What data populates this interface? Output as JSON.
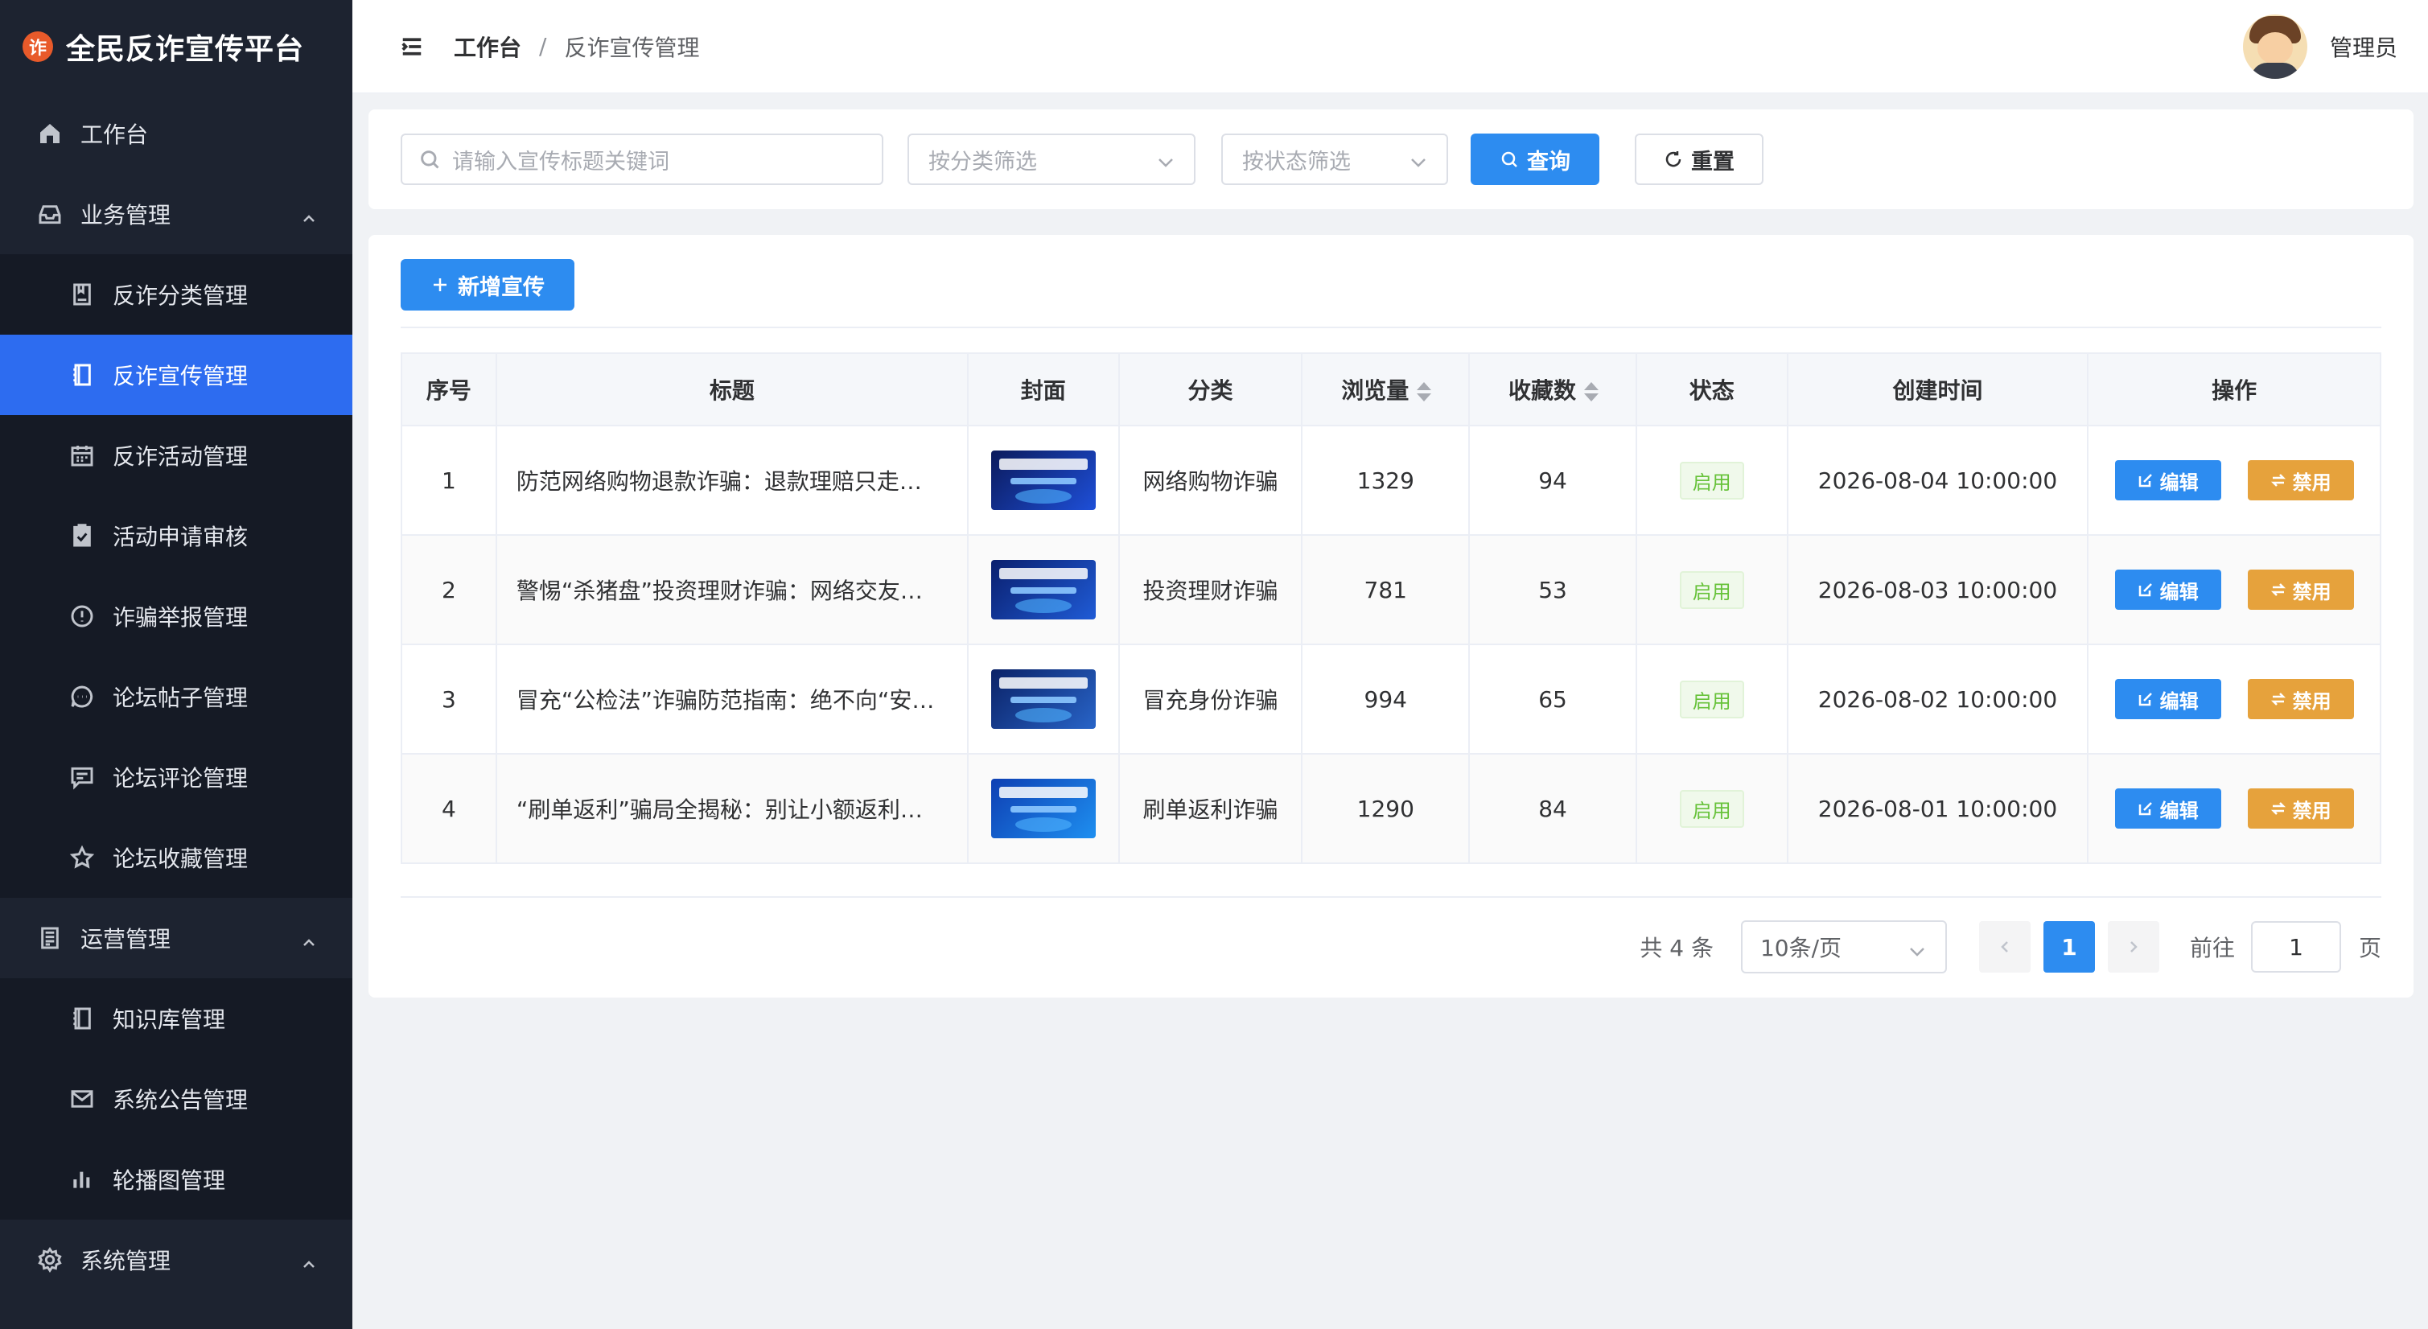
{
  "brand": {
    "logo_char": "诈",
    "name": "全民反诈宣传平台"
  },
  "sidebar": {
    "items": [
      {
        "label": "工作台",
        "icon": "home-icon"
      },
      {
        "label": "业务管理",
        "icon": "inbox-icon",
        "expanded": true
      },
      {
        "label": "反诈分类管理",
        "icon": "book-icon"
      },
      {
        "label": "反诈宣传管理",
        "icon": "notebook-icon",
        "active": true
      },
      {
        "label": "反诈活动管理",
        "icon": "calendar-icon"
      },
      {
        "label": "活动申请审核",
        "icon": "clipboard-check-icon"
      },
      {
        "label": "诈骗举报管理",
        "icon": "warning-icon"
      },
      {
        "label": "论坛帖子管理",
        "icon": "chat-icon"
      },
      {
        "label": "论坛评论管理",
        "icon": "comment-icon"
      },
      {
        "label": "论坛收藏管理",
        "icon": "star-icon"
      },
      {
        "label": "运营管理",
        "icon": "document-icon",
        "expanded": true
      },
      {
        "label": "知识库管理",
        "icon": "notebook-icon"
      },
      {
        "label": "系统公告管理",
        "icon": "mail-icon"
      },
      {
        "label": "轮播图管理",
        "icon": "bar-chart-icon"
      },
      {
        "label": "系统管理",
        "icon": "gear-icon",
        "expanded": true
      }
    ]
  },
  "header": {
    "breadcrumb": {
      "home": "工作台",
      "separator": "/",
      "current": "反诈宣传管理"
    },
    "user_name": "管理员"
  },
  "filters": {
    "search_placeholder": "请输入宣传标题关键词",
    "category_placeholder": "按分类筛选",
    "status_placeholder": "按状态筛选",
    "query_label": "查询",
    "reset_label": "重置"
  },
  "toolbar": {
    "add_label": "新增宣传"
  },
  "table": {
    "columns": [
      "序号",
      "标题",
      "封面",
      "分类",
      "浏览量",
      "收藏数",
      "状态",
      "创建时间",
      "操作"
    ],
    "rows": [
      {
        "index": "1",
        "title": "防范网络购物退款诈骗：退款理赔只走官方渠道",
        "category": "网络购物诈骗",
        "views": "1329",
        "favorites": "94",
        "status": "启用",
        "created": "2026-08-04 10:00:00"
      },
      {
        "index": "2",
        "title": "警惕“杀猪盘”投资理财诈骗：网络交友需谨慎",
        "category": "投资理财诈骗",
        "views": "781",
        "favorites": "53",
        "status": "启用",
        "created": "2026-08-03 10:00:00"
      },
      {
        "index": "3",
        "title": "冒充“公检法”诈骗防范指南：绝不向“安全账户”转账",
        "category": "冒充身份诈骗",
        "views": "994",
        "favorites": "65",
        "status": "启用",
        "created": "2026-08-02 10:00:00"
      },
      {
        "index": "4",
        "title": "“刷单返利”骗局全揭秘：别让小额返利迷了眼",
        "category": "刷单返利诈骗",
        "views": "1290",
        "favorites": "84",
        "status": "启用",
        "created": "2026-08-01 10:00:00"
      }
    ],
    "edit_label": "编辑",
    "disable_label": "禁用"
  },
  "pagination": {
    "total_text": "共 4 条",
    "page_size": "10条/页",
    "current_page": "1",
    "goto_label": "前往",
    "goto_value": "1",
    "page_suffix": "页"
  },
  "colors": {
    "sidebar_bg": "#1d2330",
    "active_menu": "#2d6cf0",
    "primary": "#2d8cf0",
    "warning": "#e6a23c",
    "success": "#67c23a"
  }
}
